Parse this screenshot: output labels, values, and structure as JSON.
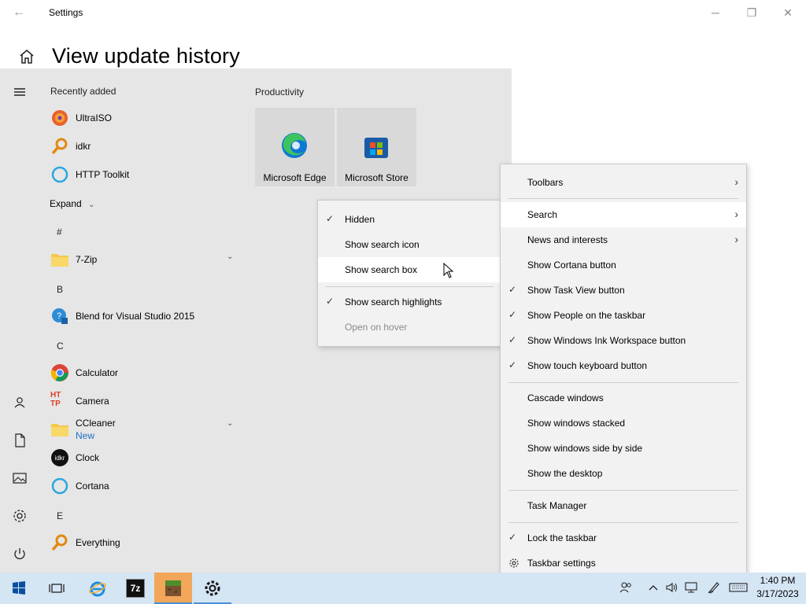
{
  "window": {
    "title": "Settings",
    "page_title": "View update history",
    "back_glyph": "←",
    "minimize_glyph": "─",
    "restore_glyph": "❐",
    "close_glyph": "✕"
  },
  "start_menu": {
    "recently_added_label": "Recently added",
    "recent_apps": [
      "UltraISO",
      "idkr",
      "HTTP Toolkit"
    ],
    "expand_label": "Expand",
    "groups": {
      "hash": "#",
      "b": "B",
      "c": "C",
      "e": "E"
    },
    "apps": {
      "sevenzip": "7-Zip",
      "blend": "Blend for Visual Studio 2015",
      "calculator": "Calculator",
      "camera": "Camera",
      "ccleaner": "CCleaner",
      "ccleaner_badge": "New",
      "clock": "Clock",
      "cortana": "Cortana",
      "everything": "Everything"
    },
    "productivity_label": "Productivity",
    "tiles": [
      "Microsoft Edge",
      "Microsoft Store"
    ]
  },
  "search_submenu": {
    "items": [
      {
        "label": "Hidden",
        "checked": true
      },
      {
        "label": "Show search icon",
        "checked": false
      },
      {
        "label": "Show search box",
        "checked": false
      },
      {
        "label": "Show search highlights",
        "checked": true
      },
      {
        "label": "Open on hover",
        "checked": false,
        "disabled": true
      }
    ]
  },
  "taskbar_menu": {
    "toolbars": "Toolbars",
    "search": "Search",
    "news": "News and interests",
    "cortana": "Show Cortana button",
    "task_view": "Show Task View button",
    "people": "Show People on the taskbar",
    "ink": "Show Windows Ink Workspace button",
    "touch_keyboard": "Show touch keyboard button",
    "cascade": "Cascade windows",
    "stacked": "Show windows stacked",
    "side_by_side": "Show windows side by side",
    "desktop": "Show the desktop",
    "task_manager": "Task Manager",
    "lock": "Lock the taskbar",
    "settings": "Taskbar settings"
  },
  "taskbar": {
    "time": "1:40 PM",
    "date": "3/17/2023",
    "sevenzip_icon_text": "7z"
  },
  "icons": {
    "idkr_text": "idkr",
    "camera_text_top": "HT",
    "camera_text_bottom": "TP"
  },
  "colors": {
    "accent": "#4a8fd9",
    "taskbar_bg": "#d4e5f4",
    "start_bg": "#e6e6e6",
    "menu_bg": "#f2f2f2"
  }
}
